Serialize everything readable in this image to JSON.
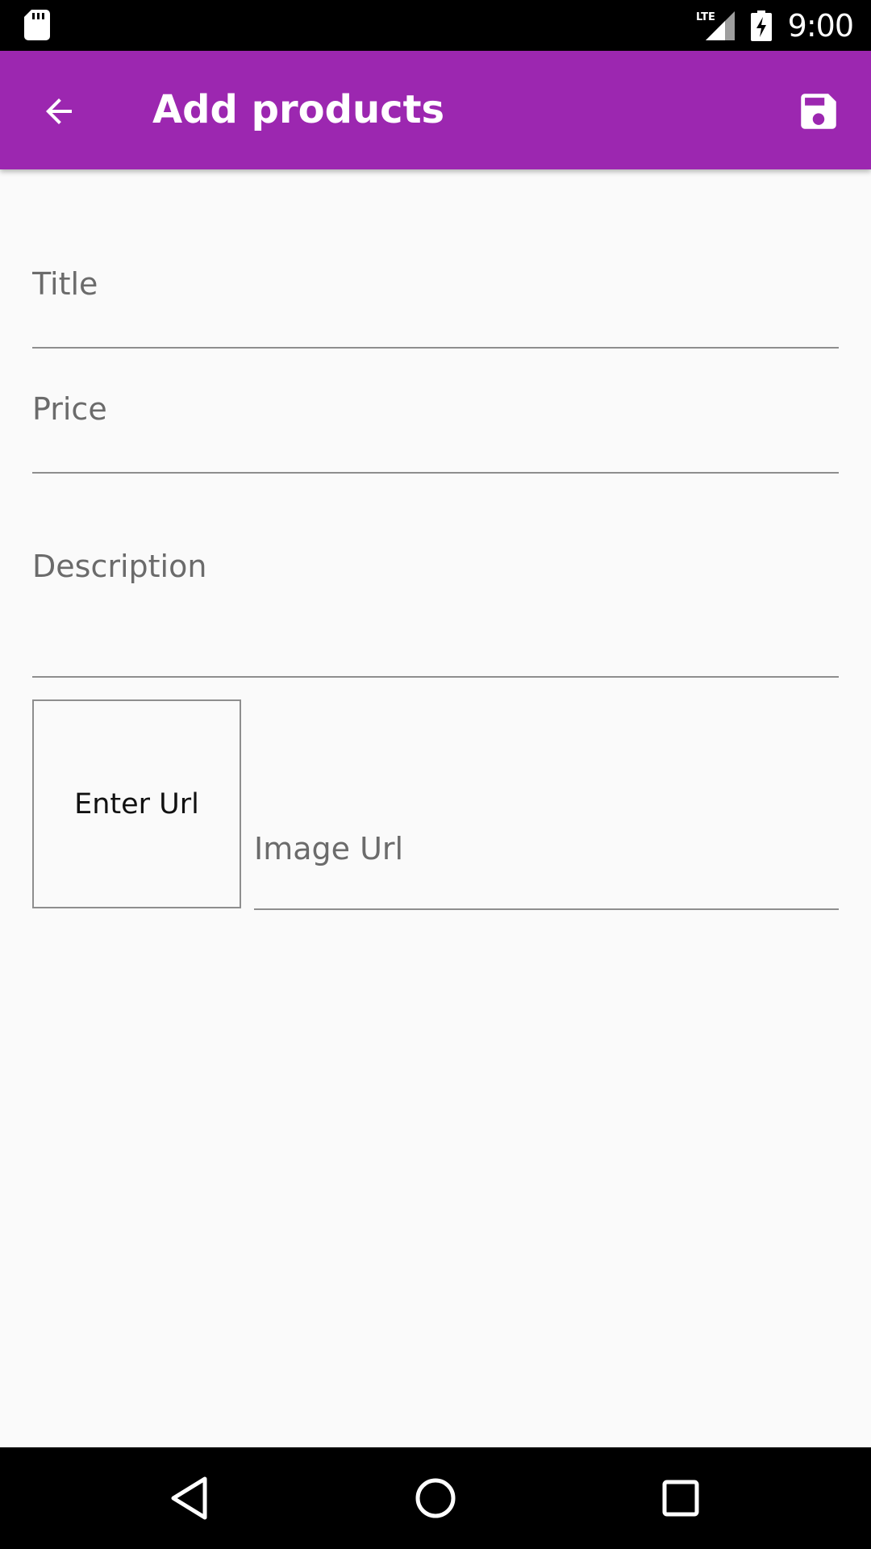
{
  "status_bar": {
    "time": "9:00",
    "icons": [
      "sd-card-icon",
      "lte-signal-icon",
      "battery-charging-icon"
    ]
  },
  "app_bar": {
    "title": "Add products",
    "back_icon": "arrow-back-icon",
    "save_icon": "save-icon",
    "color": "#9c27b0"
  },
  "form": {
    "title": {
      "value": "",
      "placeholder": "Title"
    },
    "price": {
      "value": "",
      "placeholder": "Price"
    },
    "description": {
      "value": "",
      "placeholder": "Description"
    },
    "image_preview_text": "Enter Url",
    "image_url": {
      "value": "",
      "placeholder": "Image Url"
    }
  },
  "nav_bar": {
    "icons": [
      "nav-back-icon",
      "nav-home-icon",
      "nav-recents-icon"
    ]
  }
}
